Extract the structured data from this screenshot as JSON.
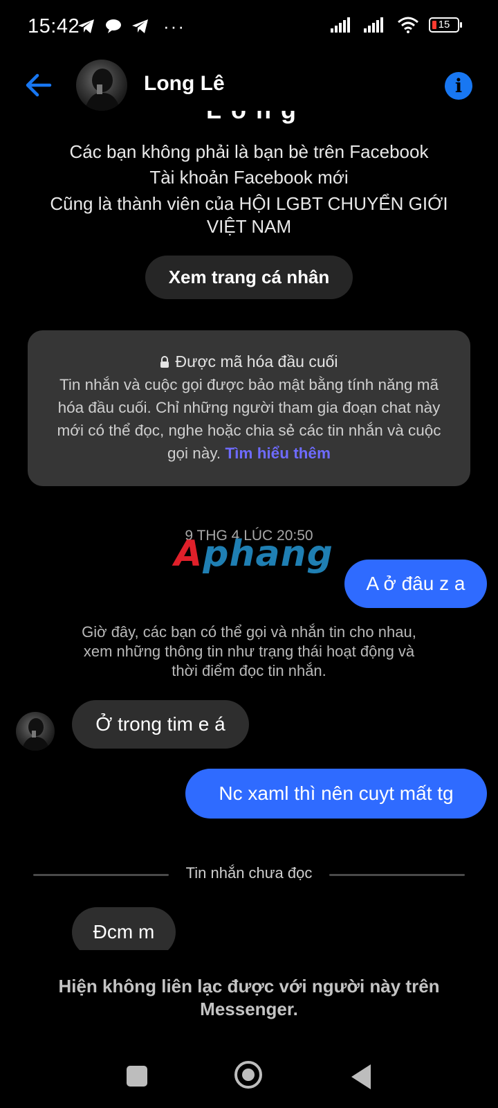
{
  "status_bar": {
    "time": "15:42",
    "battery": "15"
  },
  "header": {
    "contact_name": "Long Lê"
  },
  "profile": {
    "not_friends": "Các bạn không phải là bạn bè trên Facebook",
    "new_account": "Tài khoản Facebook mới",
    "member_line1": "Cũng là thành viên của HỘI LGBT CHUYỂN GIỚI",
    "member_line2": "VIỆT NAM",
    "view_profile_label": "Xem trang cá nhân"
  },
  "encryption": {
    "title": "Được mã hóa đầu cuối",
    "body": "Tin nhắn và cuộc gọi được bảo mật bằng tính năng mã hóa đầu cuối. Chỉ những người tham gia đoạn chat này mới có thể đọc, nghe hoặc chia sẻ các tin nhắn và cuộc gọi này.",
    "link": "Tìm hiểu thêm"
  },
  "conversation": {
    "timestamp": "9 THG 4 LÚC 20:50",
    "watermark_part1": "A",
    "watermark_part2": "phang",
    "msg1": "A ở đâu z a",
    "system_note": "Giờ đây, các bạn có thể gọi và nhắn tin cho nhau, xem những thông tin như trạng thái hoạt động và thời điểm đọc tin nhắn.",
    "msg2": "Ở trong tim e á",
    "msg3": "Nc xaml thì nên cuyt mất tg",
    "unread_divider": "Tin nhắn chưa đọc",
    "msg4": "Đcm m"
  },
  "footer": {
    "unavailable_note": "Hiện không liên lạc được với người này trên Messenger."
  },
  "colors": {
    "accent": "#2f6bff",
    "info": "#1877f2",
    "link": "#6e6bff"
  }
}
